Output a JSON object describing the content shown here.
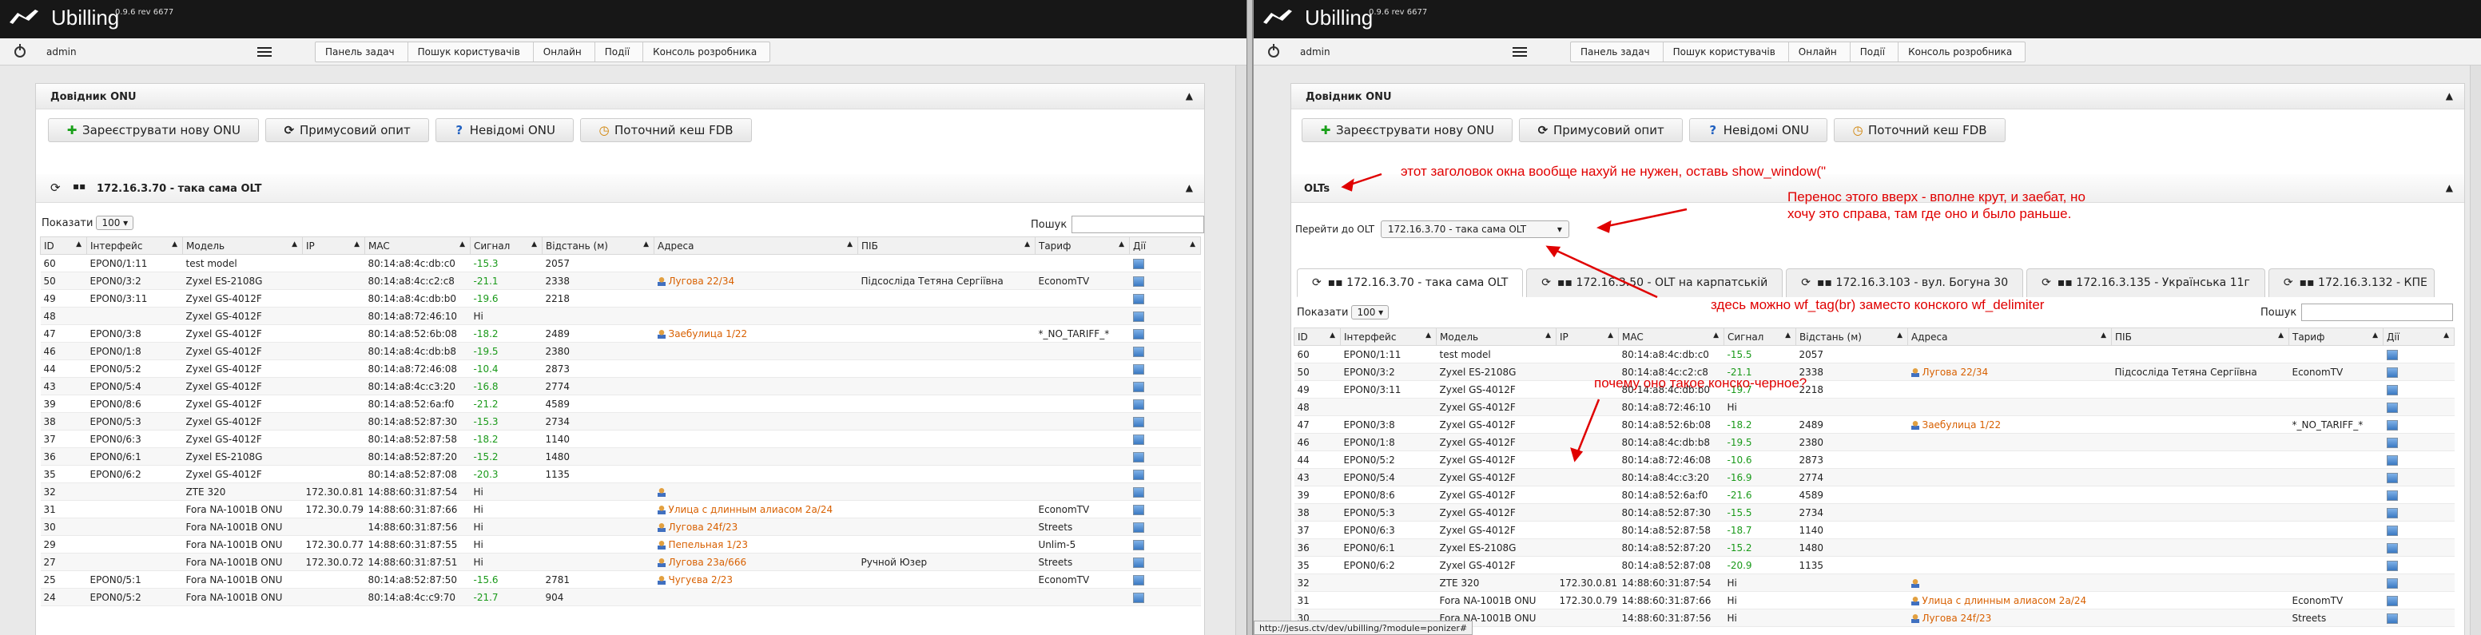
{
  "app": {
    "brand": "Ubilling",
    "version": "0.9.6 rev 6677",
    "user": "admin"
  },
  "nav": {
    "crumbs": [
      "Панель задач",
      "Пошук користувачів",
      "Онлайн",
      "Події",
      "Консоль розробника"
    ]
  },
  "panel": {
    "title": "Довідник ONU"
  },
  "buttons": {
    "register": "Зареєструвати нову ONU",
    "poll": "Примусовий опит",
    "unknown": "Невідомі ONU",
    "fdb": "Поточний кеш FDB"
  },
  "olt_section": {
    "title": "172.16.3.70 - така сама OLT",
    "olts_title": "OLTs"
  },
  "goto_olt": {
    "label": "Перейти до OLT",
    "value": "172.16.3.70 - така сама OLT"
  },
  "tabs": [
    "172.16.3.70 - така сама OLT",
    "172.16.3.50 - OLT на карпатській",
    "172.16.3.103 - вул. Богуна 30",
    "172.16.3.135 - Українська 11г",
    "172.16.3.132 - КПЕ"
  ],
  "table": {
    "show_label": "Показати",
    "show_value": "100",
    "search_label": "Пошук",
    "columns": [
      "ID",
      "Інтерфейс",
      "Модель",
      "IP",
      "MAC",
      "Сигнал",
      "Відстань (м)",
      "Адреса",
      "ПІБ",
      "Тариф",
      "Дії"
    ],
    "rows": [
      [
        "60",
        "EPON0/1:11",
        "test model",
        "",
        "80:14:a8:4c:db:c0",
        "-15.3",
        "2057",
        "",
        "",
        ""
      ],
      [
        "50",
        "EPON0/3:2",
        "Zyxel ES-2108G",
        "",
        "80:14:a8:4c:c2:c8",
        "-21.1",
        "2338",
        "Лугова 22/34",
        "Підсосліда Тетяна Сергіївна",
        "EconomTV"
      ],
      [
        "49",
        "EPON0/3:11",
        "Zyxel GS-4012F",
        "",
        "80:14:a8:4c:db:b0",
        "-19.6",
        "2218",
        "",
        "",
        ""
      ],
      [
        "48",
        "",
        "Zyxel GS-4012F",
        "",
        "80:14:a8:72:46:10",
        "Hi",
        "",
        "",
        "",
        ""
      ],
      [
        "47",
        "EPON0/3:8",
        "Zyxel GS-4012F",
        "",
        "80:14:a8:52:6b:08",
        "-18.2",
        "2489",
        "Заебулица 1/22",
        "",
        "*_NO_TARIFF_*"
      ],
      [
        "46",
        "EPON0/1:8",
        "Zyxel GS-4012F",
        "",
        "80:14:a8:4c:db:b8",
        "-19.5",
        "2380",
        "",
        "",
        ""
      ],
      [
        "44",
        "EPON0/5:2",
        "Zyxel GS-4012F",
        "",
        "80:14:a8:72:46:08",
        "-10.4",
        "2873",
        "",
        "",
        ""
      ],
      [
        "43",
        "EPON0/5:4",
        "Zyxel GS-4012F",
        "",
        "80:14:a8:4c:c3:20",
        "-16.8",
        "2774",
        "",
        "",
        ""
      ],
      [
        "39",
        "EPON0/8:6",
        "Zyxel GS-4012F",
        "",
        "80:14:a8:52:6a:f0",
        "-21.2",
        "4589",
        "",
        "",
        ""
      ],
      [
        "38",
        "EPON0/5:3",
        "Zyxel GS-4012F",
        "",
        "80:14:a8:52:87:30",
        "-15.3",
        "2734",
        "",
        "",
        ""
      ],
      [
        "37",
        "EPON0/6:3",
        "Zyxel GS-4012F",
        "",
        "80:14:a8:52:87:58",
        "-18.2",
        "1140",
        "",
        "",
        ""
      ],
      [
        "36",
        "EPON0/6:1",
        "Zyxel ES-2108G",
        "",
        "80:14:a8:52:87:20",
        "-15.2",
        "1480",
        "",
        "",
        ""
      ],
      [
        "35",
        "EPON0/6:2",
        "Zyxel GS-4012F",
        "",
        "80:14:a8:52:87:08",
        "-20.3",
        "1135",
        "",
        "",
        ""
      ],
      [
        "32",
        "",
        "ZTE 320",
        "172.30.0.81",
        "14:88:60:31:87:54",
        "Hi",
        "",
        "",
        "",
        ""
      ],
      [
        "31",
        "",
        "Fora NA-1001B ONU",
        "172.30.0.79",
        "14:88:60:31:87:66",
        "Hi",
        "",
        "Улица с длинным алиасом 2а/24",
        "",
        "EconomTV"
      ],
      [
        "30",
        "",
        "Fora NA-1001B ONU",
        "",
        "14:88:60:31:87:56",
        "Hi",
        "",
        "Лугова 24f/23",
        "",
        "Streets"
      ],
      [
        "29",
        "",
        "Fora NA-1001B ONU",
        "172.30.0.77",
        "14:88:60:31:87:55",
        "Hi",
        "",
        "Пепельная 1/23",
        "",
        "Unlim-5"
      ],
      [
        "27",
        "",
        "Fora NA-1001B ONU",
        "172.30.0.72",
        "14:88:60:31:87:51",
        "Hi",
        "",
        "Лугова 23а/666",
        "Ручной Юзер",
        "Streets"
      ],
      [
        "25",
        "EPON0/5:1",
        "Fora NA-1001B ONU",
        "",
        "80:14:a8:52:87:50",
        "-15.6",
        "2781",
        "Чугуєва 2/23",
        "",
        "EconomTV"
      ],
      [
        "24",
        "EPON0/5:2",
        "Fora NA-1001B ONU",
        "",
        "80:14:a8:4c:c9:70",
        "-21.7",
        "904",
        "",
        "",
        ""
      ]
    ],
    "rows_right": [
      [
        "60",
        "EPON0/1:11",
        "test model",
        "",
        "80:14:a8:4c:db:c0",
        "-15.5",
        "2057",
        "",
        "",
        ""
      ],
      [
        "50",
        "EPON0/3:2",
        "Zyxel ES-2108G",
        "",
        "80:14:a8:4c:c2:c8",
        "-21.1",
        "2338",
        "Лугова 22/34",
        "Підсосліда Тетяна Сергіївна",
        "EconomTV"
      ],
      [
        "49",
        "EPON0/3:11",
        "Zyxel GS-4012F",
        "",
        "80:14:a8:4c:db:b0",
        "-19.7",
        "2218",
        "",
        "",
        ""
      ],
      [
        "48",
        "",
        "Zyxel GS-4012F",
        "",
        "80:14:a8:72:46:10",
        "Hi",
        "",
        "",
        "",
        ""
      ],
      [
        "47",
        "EPON0/3:8",
        "Zyxel GS-4012F",
        "",
        "80:14:a8:52:6b:08",
        "-18.2",
        "2489",
        "Заебулица 1/22",
        "",
        "*_NO_TARIFF_*"
      ],
      [
        "46",
        "EPON0/1:8",
        "Zyxel GS-4012F",
        "",
        "80:14:a8:4c:db:b8",
        "-19.5",
        "2380",
        "",
        "",
        ""
      ],
      [
        "44",
        "EPON0/5:2",
        "Zyxel GS-4012F",
        "",
        "80:14:a8:72:46:08",
        "-10.6",
        "2873",
        "",
        "",
        ""
      ],
      [
        "43",
        "EPON0/5:4",
        "Zyxel GS-4012F",
        "",
        "80:14:a8:4c:c3:20",
        "-16.9",
        "2774",
        "",
        "",
        ""
      ],
      [
        "39",
        "EPON0/8:6",
        "Zyxel GS-4012F",
        "",
        "80:14:a8:52:6a:f0",
        "-21.6",
        "4589",
        "",
        "",
        ""
      ],
      [
        "38",
        "EPON0/5:3",
        "Zyxel GS-4012F",
        "",
        "80:14:a8:52:87:30",
        "-15.5",
        "2734",
        "",
        "",
        ""
      ],
      [
        "37",
        "EPON0/6:3",
        "Zyxel GS-4012F",
        "",
        "80:14:a8:52:87:58",
        "-18.7",
        "1140",
        "",
        "",
        ""
      ],
      [
        "36",
        "EPON0/6:1",
        "Zyxel ES-2108G",
        "",
        "80:14:a8:52:87:20",
        "-15.2",
        "1480",
        "",
        "",
        ""
      ],
      [
        "35",
        "EPON0/6:2",
        "Zyxel GS-4012F",
        "",
        "80:14:a8:52:87:08",
        "-20.9",
        "1135",
        "",
        "",
        ""
      ],
      [
        "32",
        "",
        "ZTE 320",
        "172.30.0.81",
        "14:88:60:31:87:54",
        "Hi",
        "",
        "",
        "",
        ""
      ],
      [
        "31",
        "",
        "Fora NA-1001B ONU",
        "172.30.0.79",
        "14:88:60:31:87:66",
        "Hi",
        "",
        "Улица с длинным алиасом 2а/24",
        "",
        "EconomTV"
      ],
      [
        "30",
        "",
        "Fora NA-1001B ONU",
        "",
        "14:88:60:31:87:56",
        "Hi",
        "",
        "Лугова 24f/23",
        "",
        "Streets"
      ]
    ]
  },
  "annotations": {
    "a1": "этот заголовок окна вообще нахуй не нужен, оставь show_window(\"",
    "a2": "Перенос этого вверх - вполне крут, и заебат, но",
    "a3": "хочу это справа, там где оно и было раньше.",
    "a4": "здесь можно wf_tag(br) заместо конского wf_delimiter",
    "a5": "почему оно такое конско-черное?"
  },
  "statusbar": "http://jesus.ctv/dev/ubilling/?module=ponizer#",
  "colors": {
    "header": "#171717",
    "annotation": "#e00000",
    "address": "#d86000",
    "signal": "#1a9a1a"
  }
}
